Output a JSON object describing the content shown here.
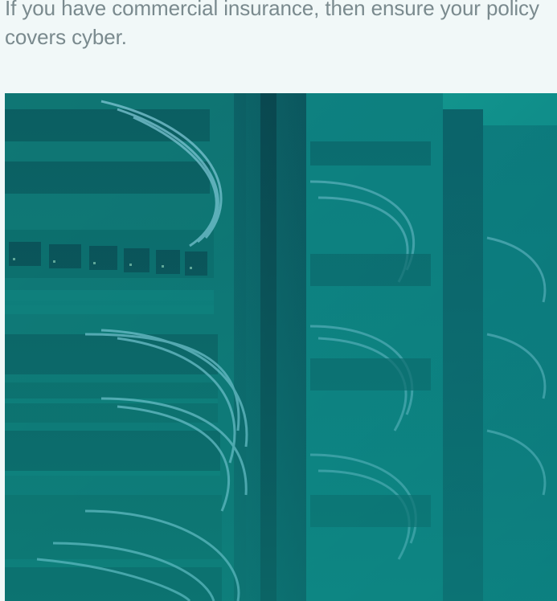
{
  "content": {
    "intro_text": "If you have commercial insurance, then ensure your policy covers cyber."
  },
  "hero_image": {
    "subject": "server-rack-photo",
    "overlay_colors": [
      "#1aa899",
      "#0a6f78",
      "#0d8a86"
    ]
  }
}
